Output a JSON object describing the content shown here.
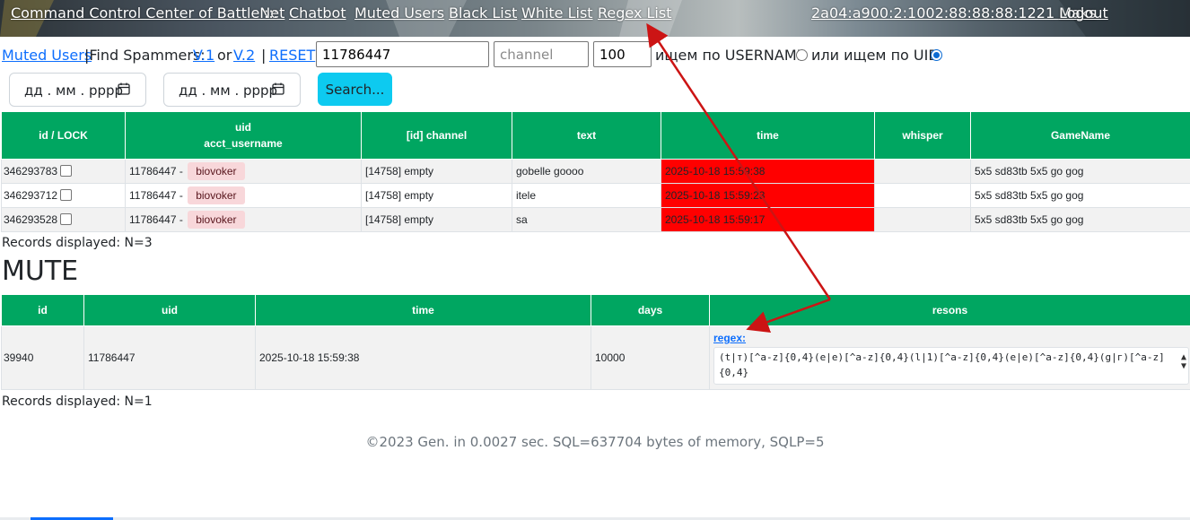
{
  "nav": {
    "brand": "Command Control Center of BattleNet",
    "separator": ":::",
    "links": [
      "Chatbot",
      "Muted Users",
      "Black List",
      "White List",
      "Regex List"
    ],
    "user": "2a04:a900:2:1002:88:88:88:1221 Maks",
    "logout": "Logout"
  },
  "filter": {
    "muted_users": "Muted Users",
    "find_spammers": "|Find Spammers:",
    "v1": "V.1",
    "or": "or",
    "v2": " V.2",
    "pipe": "|",
    "reset": "RESET",
    "search_value": "11786447",
    "channel_placeholder": "channel",
    "limit_value": "100",
    "username_label": "ищем по USERNAME",
    "uid_label": "или ищем по UID",
    "selected_mode": "UID",
    "date_placeholder_1": "дд . мм . рррр",
    "date_placeholder_2": "дд . мм . рррр",
    "search_button": "Search..."
  },
  "messages": {
    "headers": [
      "id / LOCK",
      "uid",
      "acct_username",
      "[id] channel",
      "text",
      "time",
      "whisper",
      "GameName"
    ],
    "rows": [
      {
        "id": "346293783",
        "uid": "11786447 -",
        "username": "biovoker",
        "channel": "[14758] empty",
        "text": "gobelle goooo",
        "time": "2025-10-18 15:59:38",
        "whisper": "",
        "game": "5x5 sd83tb 5x5 go gog"
      },
      {
        "id": "346293712",
        "uid": "11786447 -",
        "username": "biovoker",
        "channel": "[14758] empty",
        "text": "itele",
        "time": "2025-10-18 15:59:23",
        "whisper": "",
        "game": "5x5 sd83tb 5x5 go gog"
      },
      {
        "id": "346293528",
        "uid": "11786447 -",
        "username": "biovoker",
        "channel": "[14758] empty",
        "text": "sa",
        "time": "2025-10-18 15:59:17",
        "whisper": "",
        "game": "5x5 sd83tb 5x5 go gog"
      }
    ],
    "records": "Records displayed: N=3"
  },
  "mute": {
    "title": "MUTE",
    "headers": [
      "id",
      "uid",
      "time",
      "days",
      "resons"
    ],
    "rows": [
      {
        "id": "39940",
        "uid": "11786447",
        "time": "2025-10-18 15:59:38",
        "days": "10000",
        "reason_label": "regex:",
        "reason_value": "(t|т)[^a-z]{0,4}(e|е)[^a-z]{0,4}(l|1)[^a-z]{0,4}(e|е)[^a-z]{0,4}(g|г)[^a-z]{0,4}"
      }
    ],
    "records": "Records displayed: N=1"
  },
  "footer": "©2023 Gen. in 0.0027 sec. SQL=637704 bytes of memory, SQLP=5",
  "colors": {
    "header_green": "#00a661",
    "time_highlight": "#ff0000",
    "badge_bg": "#f8d7da",
    "annotation_arrow": "#cc1414",
    "link": "#0d6efd",
    "search_button": "#0dcaf0"
  }
}
